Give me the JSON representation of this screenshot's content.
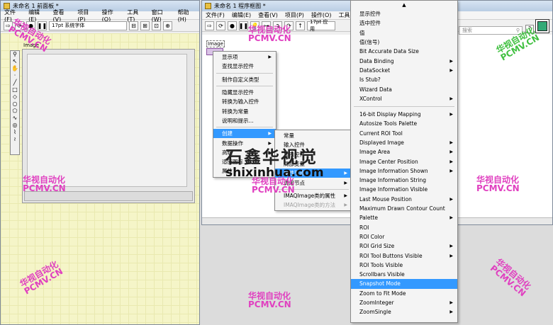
{
  "front_panel": {
    "title": "未命名 1 前面板 *",
    "menu": [
      "文件(F)",
      "编辑(E)",
      "查看(V)",
      "项目(P)",
      "操作(O)",
      "工具(T)",
      "窗口(W)",
      "帮助(H)"
    ],
    "font": "17pt 系统字体",
    "image_label": "Image"
  },
  "block_diagram": {
    "title": "未命名 1 程序框图 *",
    "menu": [
      "文件(F)",
      "编辑(E)",
      "查看(V)",
      "项目(P)",
      "操作(O)",
      "工具(T)"
    ],
    "font": "17pt 应用",
    "search_placeholder": "搜索",
    "node_label": "Image"
  },
  "context_menu": {
    "items": [
      {
        "label": "显示项",
        "arrow": true
      },
      {
        "label": "查找显示控件"
      },
      {
        "sep": true
      },
      {
        "label": "制作自定义类型"
      },
      {
        "sep": true
      },
      {
        "label": "隐藏显示控件"
      },
      {
        "label": "转换为输入控件"
      },
      {
        "label": "转换为常量"
      },
      {
        "label": "说明和提示..."
      },
      {
        "sep": true
      },
      {
        "label": "创建",
        "arrow": true,
        "hl": true
      },
      {
        "label": "数据操作",
        "arrow": true
      },
      {
        "label": "高级",
        "arrow": true
      },
      {
        "label": "适应图标"
      },
      {
        "label": "属性"
      }
    ]
  },
  "create_menu": {
    "items": [
      {
        "label": "常量"
      },
      {
        "label": "输入控件"
      },
      {
        "label": "显示控件"
      },
      {
        "label": "局部变量"
      },
      {
        "label": "属性节点",
        "arrow": true,
        "hl": true
      },
      {
        "label": "调用节点",
        "arrow": true
      },
      {
        "sep": true
      },
      {
        "label": "IMAQImage类的属性",
        "arrow": true
      },
      {
        "label": "IMAQImage类的方法",
        "arrow": true,
        "dis": true
      }
    ]
  },
  "property_menu": {
    "scroll_up": "▲",
    "items": [
      {
        "label": "显示控件"
      },
      {
        "label": "选中控件"
      },
      {
        "label": "值"
      },
      {
        "label": "值(信号)"
      },
      {
        "label": "Bit Accurate Data Size"
      },
      {
        "label": "Data Binding",
        "arrow": true
      },
      {
        "label": "DataSocket",
        "arrow": true
      },
      {
        "label": "Is Stub?"
      },
      {
        "label": "Wizard Data"
      },
      {
        "label": "XControl",
        "arrow": true
      },
      {
        "sep": true
      },
      {
        "label": "16-bit Display Mapping",
        "arrow": true
      },
      {
        "label": "Autosize Tools Palette"
      },
      {
        "label": "Current ROI Tool"
      },
      {
        "label": "Displayed Image",
        "arrow": true
      },
      {
        "label": "Image Area",
        "arrow": true
      },
      {
        "label": "Image Center Position",
        "arrow": true
      },
      {
        "label": "Image Information Shown",
        "arrow": true
      },
      {
        "label": "Image Information String"
      },
      {
        "label": "Image Information Visible"
      },
      {
        "label": "Last Mouse Position",
        "arrow": true
      },
      {
        "label": "Maximum Drawn Contour Count"
      },
      {
        "label": "Palette",
        "arrow": true
      },
      {
        "label": "ROI"
      },
      {
        "label": "ROI Color"
      },
      {
        "label": "ROI Grid Size",
        "arrow": true
      },
      {
        "label": "ROI Tool Buttons Visible",
        "arrow": true
      },
      {
        "label": "ROI Tools Visible"
      },
      {
        "label": "Scrollbars Visible"
      },
      {
        "label": "Snapshot Mode",
        "hl": true
      },
      {
        "label": "Zoom to Fit Mode"
      },
      {
        "label": "ZoomInteger",
        "arrow": true
      },
      {
        "label": "ZoomSingle",
        "arrow": true
      }
    ]
  },
  "watermarks": {
    "cn": "华视自动化",
    "en": "PCMV.CN",
    "site_cn": "石鑫华视觉",
    "site_en": "shixinhua.com"
  },
  "colors": {
    "highlight": "#3399ff",
    "grid": "#f5f5c8",
    "watermark": "#e040c0"
  }
}
